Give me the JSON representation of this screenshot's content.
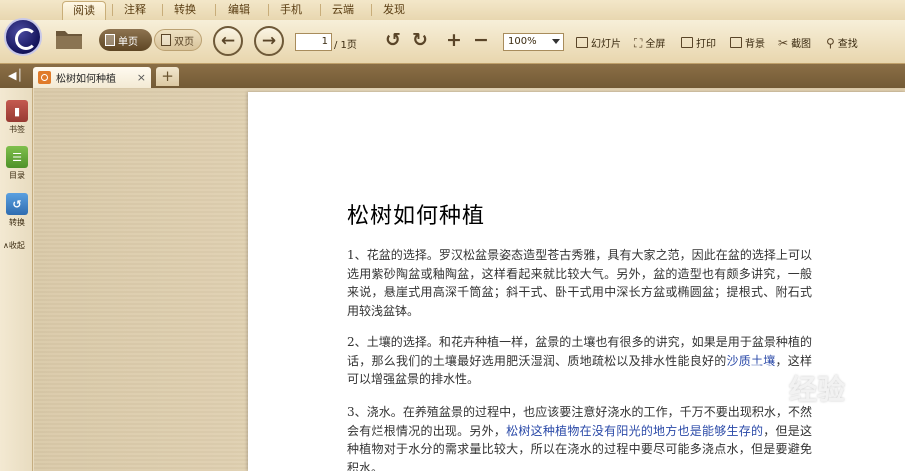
{
  "menu": {
    "tabs": [
      "阅读",
      "注释",
      "转换",
      "编辑",
      "手机",
      "云端",
      "发现"
    ]
  },
  "toolbar": {
    "single_page": "单页",
    "double_page": "双页",
    "page_input": "1",
    "page_total": "/ 1页",
    "zoom": "100%",
    "buttons": [
      "幻灯片",
      "全屏",
      "打印",
      "背景",
      "截图",
      "查找"
    ]
  },
  "doc_tab": {
    "title": "松树如何种植",
    "close": "×",
    "new_tab": "+"
  },
  "sidebar": {
    "items": [
      "书签",
      "目录",
      "转换"
    ],
    "collapse": "收起"
  },
  "document": {
    "title": "松树如何种植",
    "p1": "1、花盆的选择。罗汉松盆景姿态造型苍古秀雅，具有大家之范，因此在盆的选择上可以选用紫砂陶盆或釉陶盆，这样看起来就比较大气。另外，盆的造型也有颇多讲究，一般来说，悬崖式用高深千筒盆；斜干式、卧干式用中深长方盆或椭圆盆；提根式、附石式用较浅盆钵。",
    "p2_a": "2、土壤的选择。和花卉种植一样，盆景的土壤也有很多的讲究，如果是用于盆景种植的话，那么我们的土壤最好选用肥沃湿润、质地疏松以及排水性能良好的",
    "p2_link": "沙质土壤",
    "p2_b": "，这样可以增强盆景的排水性。",
    "p3_a": "3、浇水。在养殖盆景的过程中，也应该要注意好浇水的工作，千万不要出现积水，不然会有烂根情况的出现。另外，",
    "p3_link": "松树这种植物在没有阳光的地方也是能够生存的",
    "p3_b": "，但是这种植物对于水分的需求量比较大，所以在浇水的过程中要尽可能多浇点水，但是要避免积水。"
  },
  "watermark": {
    "text": "经验"
  },
  "colors": {
    "link": "#2b4aa8",
    "tabstrip": "#7d6440",
    "accent_brown": "#5e4624"
  }
}
